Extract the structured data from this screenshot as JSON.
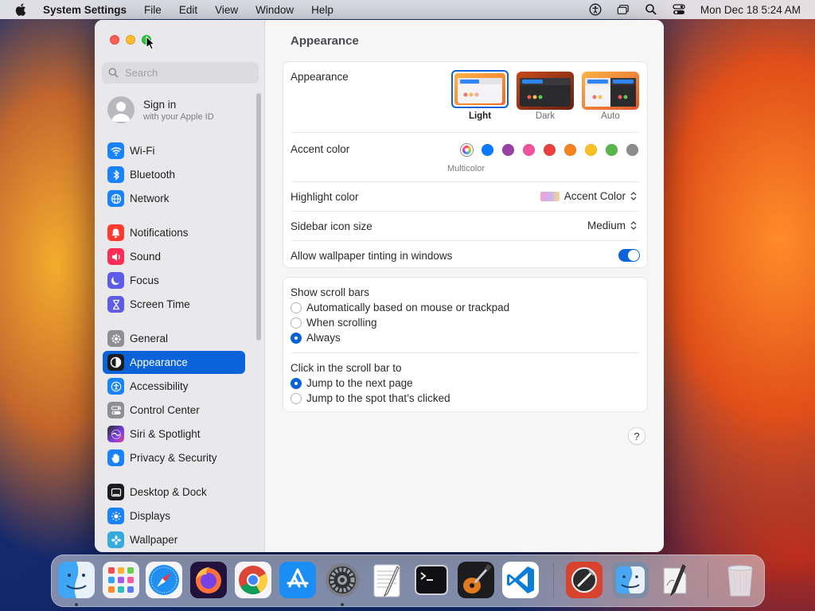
{
  "menubar": {
    "app_name": "System Settings",
    "menus": [
      "File",
      "Edit",
      "View",
      "Window",
      "Help"
    ],
    "clock": "Mon Dec 18  5:24 AM",
    "status_icons": [
      "accessibility-icon",
      "screen-mirroring-icon",
      "spotlight-search-icon",
      "control-center-icon"
    ]
  },
  "sidebar": {
    "search_placeholder": "Search",
    "account": {
      "name": "Sign in",
      "subtitle": "with your Apple ID"
    },
    "items": [
      {
        "label": "Wi-Fi",
        "icon": "wifi-icon",
        "color": "#1a82fb"
      },
      {
        "label": "Bluetooth",
        "icon": "bluetooth-icon",
        "color": "#1a82fb"
      },
      {
        "label": "Network",
        "icon": "globe-icon",
        "color": "#1a82fb"
      },
      {
        "label": "Notifications",
        "icon": "bell-icon",
        "color": "#ff3b30"
      },
      {
        "label": "Sound",
        "icon": "speaker-icon",
        "color": "#ff2d55"
      },
      {
        "label": "Focus",
        "icon": "moon-icon",
        "color": "#5e5ce6"
      },
      {
        "label": "Screen Time",
        "icon": "hourglass-icon",
        "color": "#5e5ce6"
      },
      {
        "label": "General",
        "icon": "gear-icon",
        "color": "#8e8e93"
      },
      {
        "label": "Appearance",
        "icon": "appearance-icon",
        "color": "#1c1c1e",
        "selected": true
      },
      {
        "label": "Accessibility",
        "icon": "accessibility-icon",
        "color": "#1a82fb"
      },
      {
        "label": "Control Center",
        "icon": "control-center-icon",
        "color": "#8e8e93"
      },
      {
        "label": "Siri & Spotlight",
        "icon": "siri-icon",
        "color": "#7b3fe4"
      },
      {
        "label": "Privacy & Security",
        "icon": "hand-icon",
        "color": "#1a82fb"
      },
      {
        "label": "Desktop & Dock",
        "icon": "dock-icon",
        "color": "#1c1c1e"
      },
      {
        "label": "Displays",
        "icon": "sun-icon",
        "color": "#1a82fb"
      },
      {
        "label": "Wallpaper",
        "icon": "flower-icon",
        "color": "#36aadc"
      }
    ]
  },
  "content": {
    "title": "Appearance",
    "appearance": {
      "label": "Appearance",
      "options": [
        {
          "label": "Light",
          "selected": true
        },
        {
          "label": "Dark",
          "selected": false
        },
        {
          "label": "Auto",
          "selected": false
        }
      ]
    },
    "accent": {
      "label": "Accent color",
      "selected_caption": "Multicolor",
      "colors": [
        "multicolor",
        "#0a7aff",
        "#9a3fa8",
        "#f1539b",
        "#e8403f",
        "#f7821b",
        "#fbc123",
        "#58b64b",
        "#8c8c8c"
      ]
    },
    "highlight": {
      "label": "Highlight color",
      "value": "Accent Color"
    },
    "sidebar_icon_size": {
      "label": "Sidebar icon size",
      "value": "Medium"
    },
    "wallpaper_tinting": {
      "label": "Allow wallpaper tinting in windows",
      "enabled": true
    },
    "scroll_bars": {
      "label": "Show scroll bars",
      "options": [
        {
          "label": "Automatically based on mouse or trackpad",
          "selected": false
        },
        {
          "label": "When scrolling",
          "selected": false
        },
        {
          "label": "Always",
          "selected": true
        }
      ]
    },
    "click_scroll": {
      "label": "Click in the scroll bar to",
      "options": [
        {
          "label": "Jump to the next page",
          "selected": true
        },
        {
          "label": "Jump to the spot that’s clicked",
          "selected": false
        }
      ]
    },
    "help_label": "?"
  },
  "dock": {
    "apps": [
      "Finder",
      "Launchpad",
      "Safari",
      "Firefox",
      "Google Chrome",
      "App Store",
      "System Settings",
      "TextEdit",
      "Terminal",
      "GarageBand",
      "Visual Studio Code",
      "Instruments",
      "Finder Utility",
      "Script Editor",
      "Trash"
    ],
    "running": [
      "Finder",
      "System Settings"
    ]
  }
}
